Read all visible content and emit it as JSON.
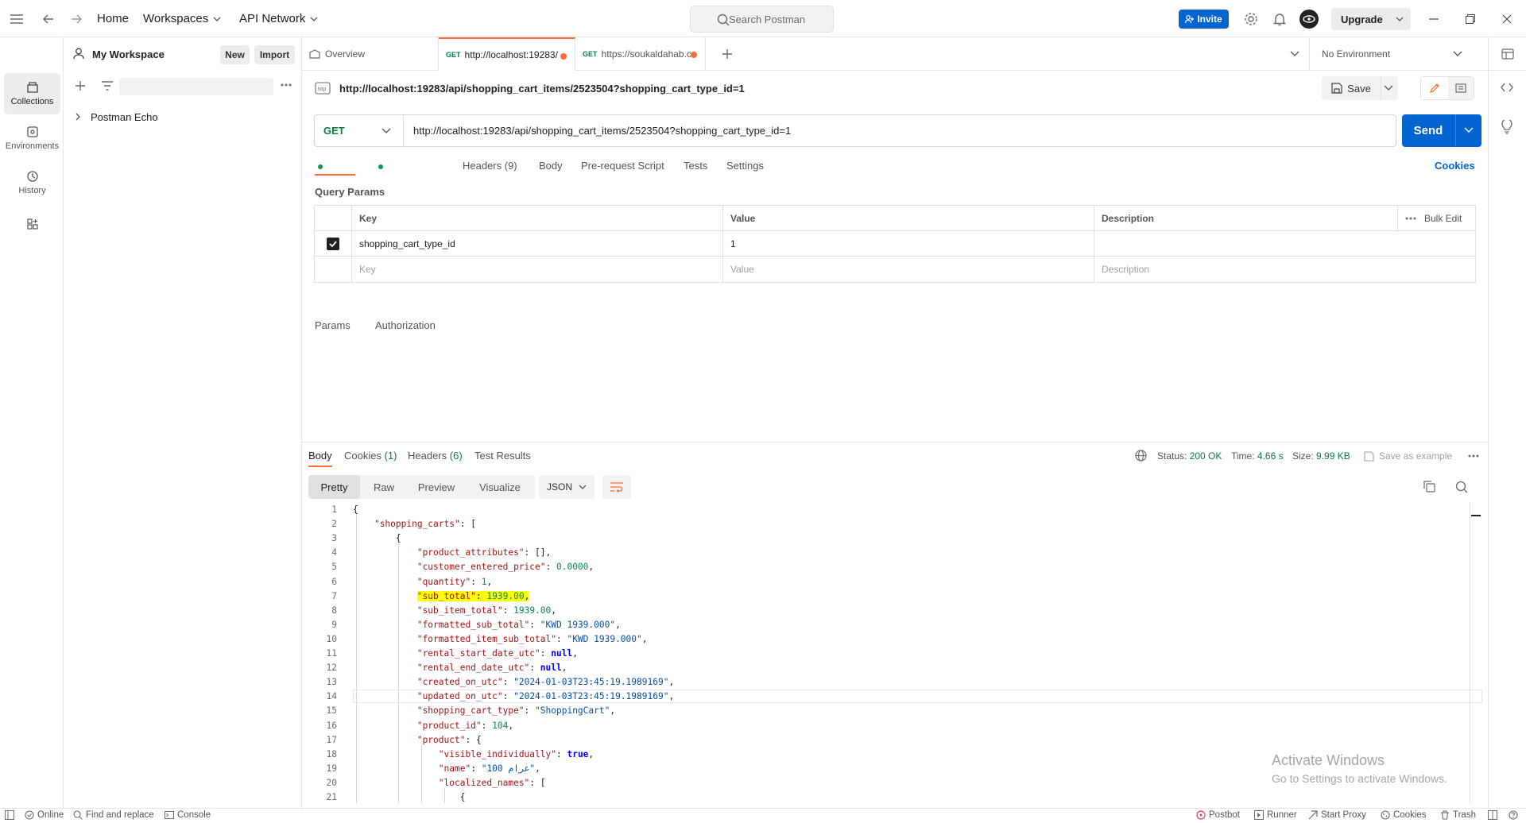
{
  "topbar": {
    "home": "Home",
    "workspaces": "Workspaces",
    "api_network": "API Network",
    "search_placeholder": "Search Postman",
    "invite": "Invite",
    "upgrade": "Upgrade"
  },
  "sidebar": {
    "items": [
      {
        "label": "Collections",
        "icon": "collections-icon"
      },
      {
        "label": "Environments",
        "icon": "environments-icon"
      },
      {
        "label": "History",
        "icon": "history-icon"
      }
    ],
    "workspace_name": "My Workspace",
    "new_label": "New",
    "import_label": "Import",
    "collections": [
      {
        "label": "Postman Echo"
      }
    ]
  },
  "tabs": [
    {
      "label": "Overview"
    },
    {
      "method": "GET",
      "label": "http://localhost:19283/"
    },
    {
      "method": "GET",
      "label": "https://soukaldahab.cc"
    }
  ],
  "environment": "No Environment",
  "request": {
    "title": "http://localhost:19283/api/shopping_cart_items/2523504?shopping_cart_type_id=1",
    "save_label": "Save",
    "method": "GET",
    "url": "http://localhost:19283/api/shopping_cart_items/2523504?shopping_cart_type_id=1",
    "send_label": "Send",
    "tabs": [
      "Params",
      "Authorization",
      "Headers (9)",
      "Body",
      "Pre-request Script",
      "Tests",
      "Settings"
    ],
    "cookies_label": "Cookies",
    "query_params_title": "Query Params",
    "params_headers": {
      "key": "Key",
      "value": "Value",
      "description": "Description",
      "bulk_edit": "Bulk Edit"
    },
    "params": [
      {
        "key": "shopping_cart_type_id",
        "value": "1",
        "checked": true
      }
    ],
    "params_placeholder": {
      "key": "Key",
      "value": "Value",
      "description": "Description"
    }
  },
  "response": {
    "tabs": {
      "body": "Body",
      "cookies": "Cookies",
      "cookies_count": "(1)",
      "headers": "Headers",
      "headers_count": "(6)",
      "test_results": "Test Results"
    },
    "status_label": "Status:",
    "status": "200 OK",
    "time_label": "Time:",
    "time": "4.66 s",
    "size_label": "Size:",
    "size": "9.99 KB",
    "save_example": "Save as example",
    "view_tabs": [
      "Pretty",
      "Raw",
      "Preview",
      "Visualize"
    ],
    "format": "JSON",
    "code_lines": [
      {
        "n": "1",
        "t": "{"
      },
      {
        "n": "2",
        "t": "    \"shopping_carts\": ["
      },
      {
        "n": "3",
        "t": "        {"
      },
      {
        "n": "4",
        "t": "            \"product_attributes\": [],"
      },
      {
        "n": "5",
        "t": "            \"customer_entered_price\": 0.0000,"
      },
      {
        "n": "6",
        "t": "            \"quantity\": 1,"
      },
      {
        "n": "7",
        "t": "            \"sub_total\": 1939.00,"
      },
      {
        "n": "8",
        "t": "            \"sub_item_total\": 1939.00,"
      },
      {
        "n": "9",
        "t": "            \"formatted_sub_total\": \"KWD 1939.000\","
      },
      {
        "n": "10",
        "t": "            \"formatted_item_sub_total\": \"KWD 1939.000\","
      },
      {
        "n": "11",
        "t": "            \"rental_start_date_utc\": null,"
      },
      {
        "n": "12",
        "t": "            \"rental_end_date_utc\": null,"
      },
      {
        "n": "13",
        "t": "            \"created_on_utc\": \"2024-01-03T23:45:19.1989169\","
      },
      {
        "n": "14",
        "t": "            \"updated_on_utc\": \"2024-01-03T23:45:19.1989169\","
      },
      {
        "n": "15",
        "t": "            \"shopping_cart_type\": \"ShoppingCart\","
      },
      {
        "n": "16",
        "t": "            \"product_id\": 104,"
      },
      {
        "n": "17",
        "t": "            \"product\": {"
      },
      {
        "n": "18",
        "t": "                \"visible_individually\": true,"
      },
      {
        "n": "19",
        "t": "                \"name\": \"100 غرام\","
      },
      {
        "n": "20",
        "t": "                \"localized_names\": ["
      },
      {
        "n": "21",
        "t": "                    {"
      }
    ]
  },
  "watermark": {
    "line1": "Activate Windows",
    "line2": "Go to Settings to activate Windows."
  },
  "statusbar": {
    "online": "Online",
    "find_replace": "Find and replace",
    "console": "Console",
    "postbot": "Postbot",
    "runner": "Runner",
    "start_proxy": "Start Proxy",
    "cookies": "Cookies",
    "trash": "Trash"
  }
}
